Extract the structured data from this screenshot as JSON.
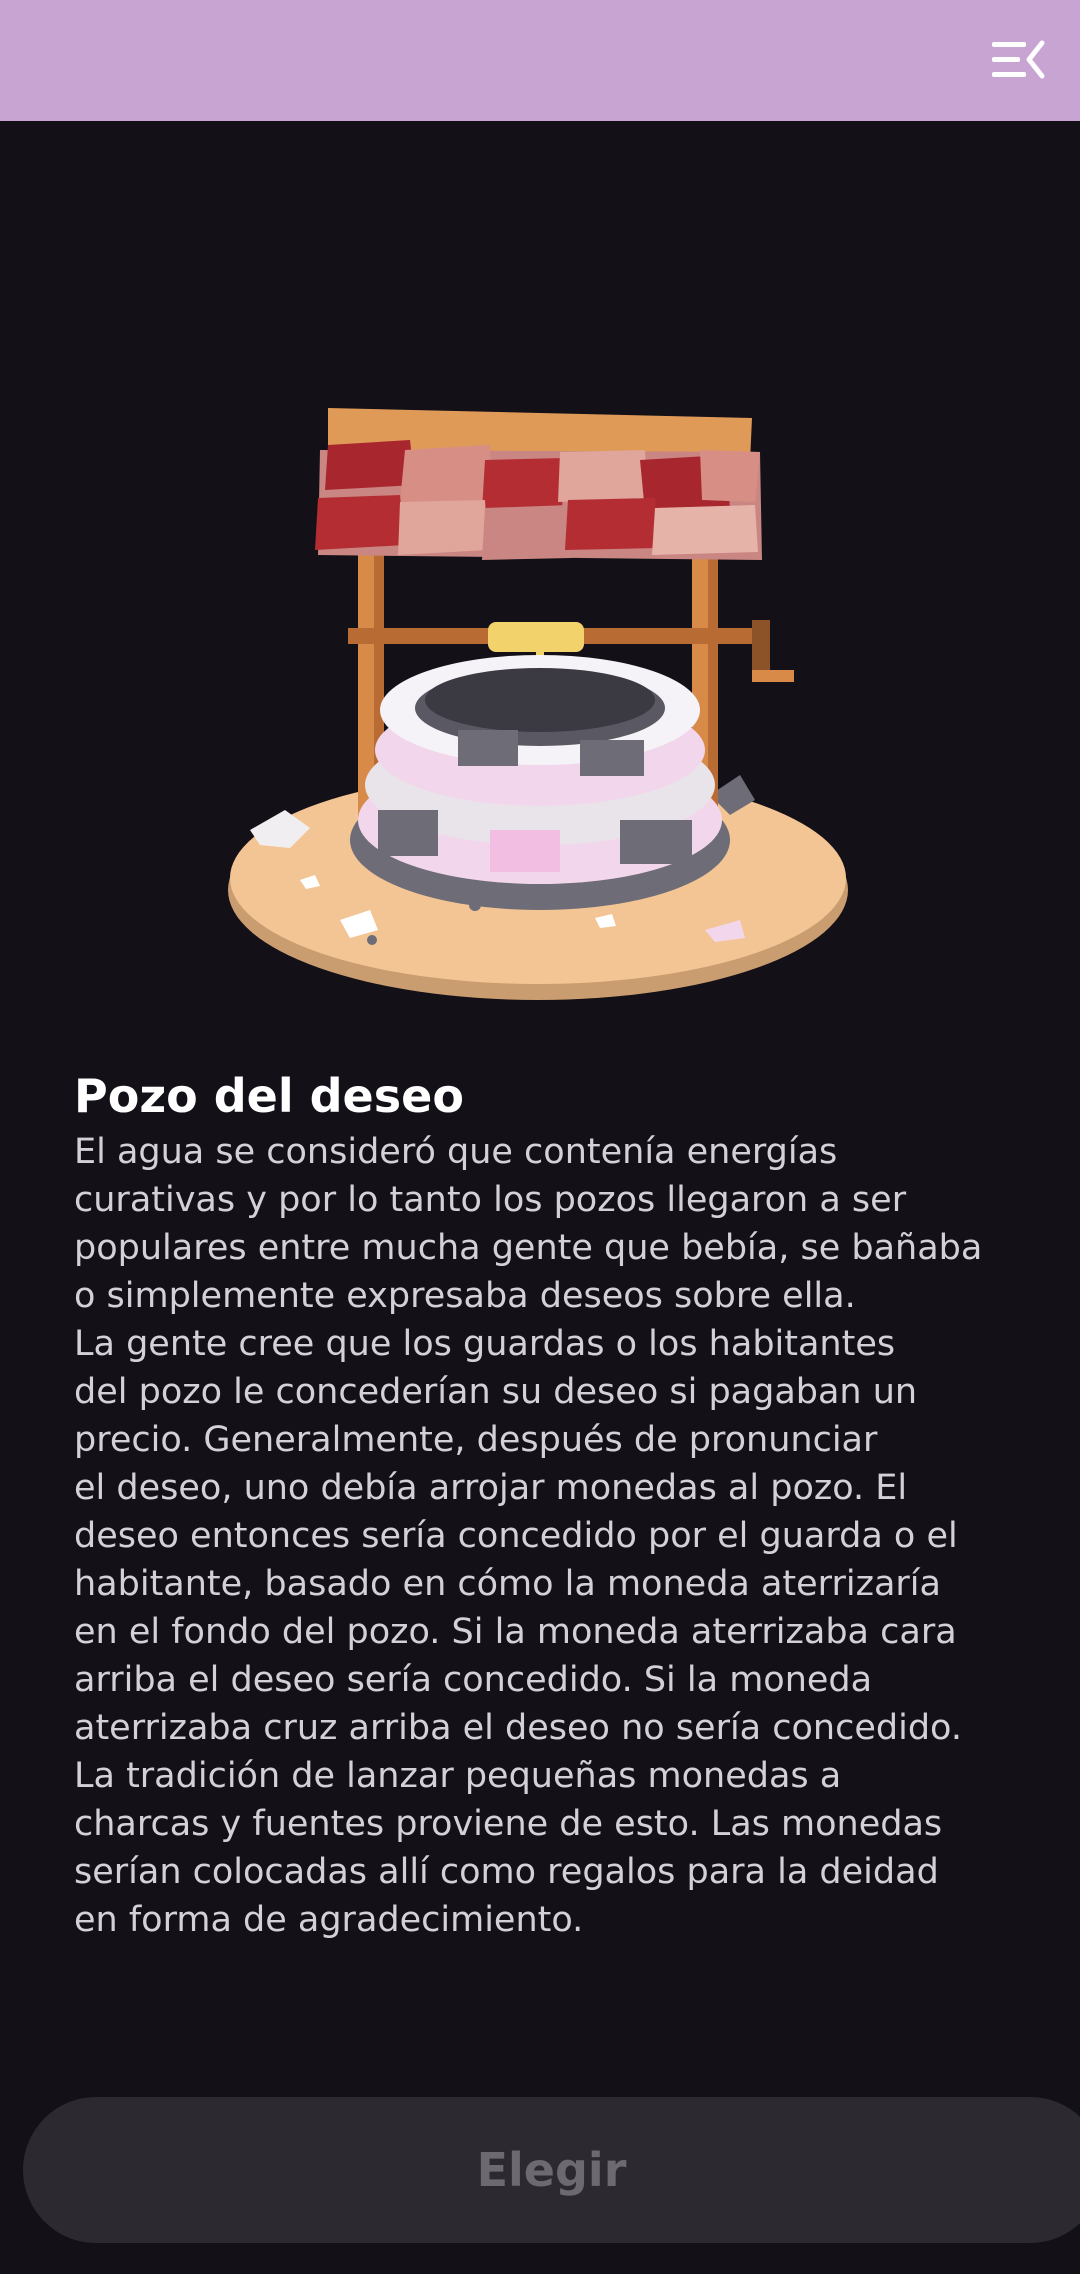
{
  "header": {
    "menu_icon": "menu-collapse-icon",
    "background_color": "#c8a4d3"
  },
  "hero": {
    "image_icon": "wishing-well-illustration"
  },
  "item": {
    "title": "Pozo del deseo",
    "description": "El agua se consideró que contenía energías\ncurativas y por lo tanto los pozos llegaron a ser\npopulares entre mucha gente que bebía, se bañaba\no simplemente expresaba deseos sobre ella.\nLa gente cree que los guardas o los habitantes\ndel pozo le concederían su deseo si pagaban un\nprecio. Generalmente, después de pronunciar\nel deseo, uno debía arrojar monedas al pozo. El\ndeseo entonces sería concedido por el guarda o el\nhabitante, basado en cómo la moneda aterrizaría\nen el fondo del pozo. Si la moneda aterrizaba cara\narriba el deseo sería concedido. Si la moneda\naterrizaba cruz arriba el deseo no sería concedido.\nLa tradición de lanzar pequeñas monedas a\ncharcas y fuentes proviene de esto. Las monedas\nserían colocadas allí como regalos para la deidad\nen forma de agradecimiento."
  },
  "actions": {
    "choose_label": "Elegir",
    "choose_enabled": false
  }
}
